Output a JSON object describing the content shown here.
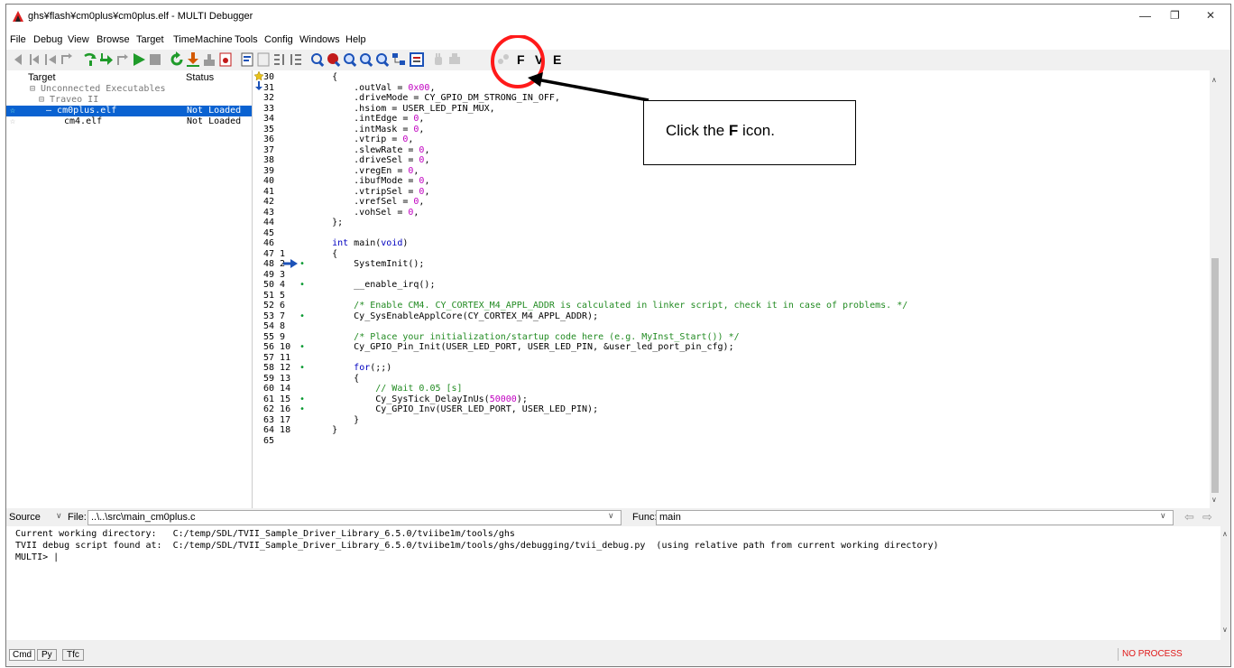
{
  "window": {
    "title": "ghs¥flash¥cm0plus¥cm0plus.elf - MULTI Debugger",
    "controls": [
      "—",
      "❐",
      "✕"
    ]
  },
  "menu": [
    "File",
    "Debug",
    "View",
    "Browse",
    "Target",
    "TimeMachine",
    "Tools",
    "Config",
    "Windows",
    "Help"
  ],
  "toolbar": {
    "letters": [
      "F",
      "V",
      "E"
    ],
    "icon_colors": {
      "green": "#1f9b2a",
      "red": "#c21a1a",
      "blue": "#1c52b8",
      "gray": "#9a9a9a"
    }
  },
  "target_pane": {
    "headers": {
      "target": "Target",
      "status": "Status"
    },
    "rows": [
      {
        "name": "⊟ Unconnected Executables",
        "status": ""
      },
      {
        "name": "⊟ Traveo II",
        "status": ""
      },
      {
        "name": "cm0plus.elf",
        "status": "Not Loaded"
      },
      {
        "name": "cm4.elf",
        "status": "Not Loaded"
      }
    ]
  },
  "source": {
    "file_lines": [
      "30",
      "31",
      "32",
      "33",
      "34",
      "35",
      "36",
      "37",
      "38",
      "39",
      "40",
      "41",
      "42",
      "43",
      "44",
      "45",
      "46",
      "47",
      "48",
      "49",
      "50",
      "51",
      "52",
      "53",
      "54",
      "55",
      "56",
      "57",
      "58",
      "59",
      "60",
      "61",
      "62",
      "63",
      "64",
      "65"
    ],
    "rel_lines": [
      "",
      "",
      "",
      "",
      "",
      "",
      "",
      "",
      "",
      "",
      "",
      "",
      "",
      "",
      "",
      "",
      "",
      "1",
      "2",
      "3",
      "4",
      "5",
      "6",
      "7",
      "8",
      "9",
      "10",
      "11",
      "12",
      "13",
      "14",
      "15",
      "16",
      "17",
      "18",
      ""
    ],
    "code": [
      "    {",
      "        .outVal = 0x00,",
      "        .driveMode = CY_GPIO_DM_STRONG_IN_OFF,",
      "        .hsiom = USER_LED_PIN_MUX,",
      "        .intEdge = 0,",
      "        .intMask = 0,",
      "        .vtrip = 0,",
      "        .slewRate = 0,",
      "        .driveSel = 0,",
      "        .vregEn = 0,",
      "        .ibufMode = 0,",
      "        .vtripSel = 0,",
      "        .vrefSel = 0,",
      "        .vohSel = 0,",
      "    };",
      "",
      "    int main(void)",
      "    {",
      "        SystemInit();",
      "",
      "        __enable_irq();",
      "",
      "        /* Enable CM4. CY_CORTEX_M4_APPL_ADDR is calculated in linker script, check it in case of problems. */",
      "        Cy_SysEnableApplCore(CY_CORTEX_M4_APPL_ADDR);",
      "",
      "        /* Place your initialization/startup code here (e.g. MyInst_Start()) */",
      "        Cy_GPIO_Pin_Init(USER_LED_PORT, USER_LED_PIN, &user_led_port_pin_cfg);",
      "",
      "        for(;;)",
      "        {",
      "            // Wait 0.05 [s]",
      "            Cy_SysTick_DelayInUs(50000);",
      "            Cy_GPIO_Inv(USER_LED_PORT, USER_LED_PIN);",
      "        }",
      "    }",
      ""
    ],
    "breakpoint_markers": [
      18,
      20,
      23,
      26,
      28,
      31,
      32
    ],
    "current_line_index": 18
  },
  "callout": {
    "prefix": "Click the ",
    "bold": "F",
    "suffix": " icon."
  },
  "status_row": {
    "source_label": "Source",
    "file_label": "File:",
    "file_value": "..\\..\\src\\main_cm0plus.c",
    "func_label": "Func:",
    "func_value": "main"
  },
  "console": {
    "lines": [
      "Current working directory:   C:/temp/SDL/TVII_Sample_Driver_Library_6.5.0/tviibe1m/tools/ghs",
      "TVII debug script found at:  C:/temp/SDL/TVII_Sample_Driver_Library_6.5.0/tviibe1m/tools/ghs/debugging/tvii_debug.py  (using relative path from current working directory)",
      "MULTI> |"
    ]
  },
  "bottom_tabs": [
    "Cmd",
    "Py",
    "Tfc"
  ],
  "process_status": "NO PROCESS"
}
